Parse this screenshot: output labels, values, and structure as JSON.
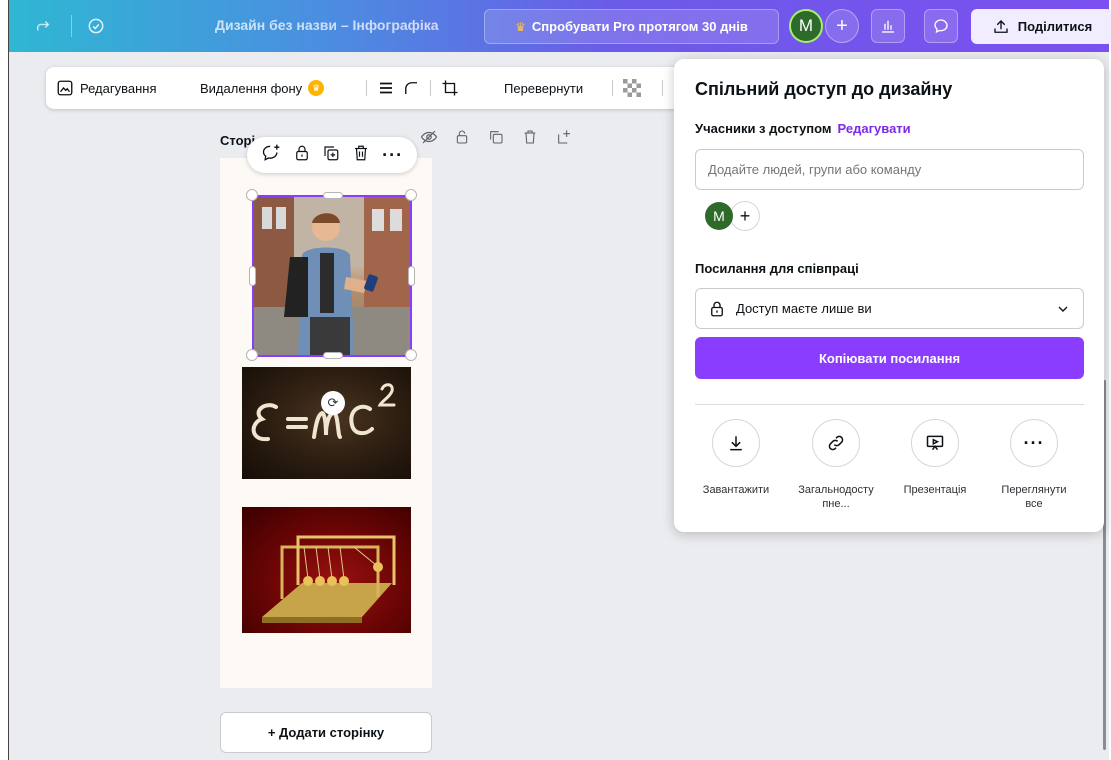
{
  "topbar": {
    "title": "Дизайн без назви – Інфографіка",
    "pro_label": "Спробувати Pro протягом 30 днів",
    "avatar_initial": "M",
    "add_label": "+",
    "share_label": "Поділитися"
  },
  "toolbar": {
    "edit_label": "Редагування",
    "remove_bg_label": "Видалення фону",
    "flip_label": "Перевернути"
  },
  "page": {
    "label": "Сторі",
    "add_page_label": "+ Додати сторінку"
  },
  "share_panel": {
    "title": "Спільний доступ до дизайну",
    "members_label": "Учасники з доступом",
    "edit_link": "Редагувати",
    "add_people_placeholder": "Додайте людей, групи або команду",
    "avatar_initial": "M",
    "plus_label": "+",
    "collab_link_label": "Посилання для співпраці",
    "access_value": "Доступ маєте лише ви",
    "copy_link_label": "Копіювати посилання",
    "actions": [
      {
        "label": "Завантажити",
        "icon": "download-icon"
      },
      {
        "label": "Загальнодосту пне...",
        "icon": "link-icon"
      },
      {
        "label": "Презентація",
        "icon": "present-icon"
      },
      {
        "label": "Переглянути все",
        "icon": "more-icon"
      }
    ]
  },
  "colors": {
    "accent": "#8b3dff",
    "topbar_gradient_start": "#2fb7d2",
    "topbar_gradient_end": "#7c4ff0"
  }
}
